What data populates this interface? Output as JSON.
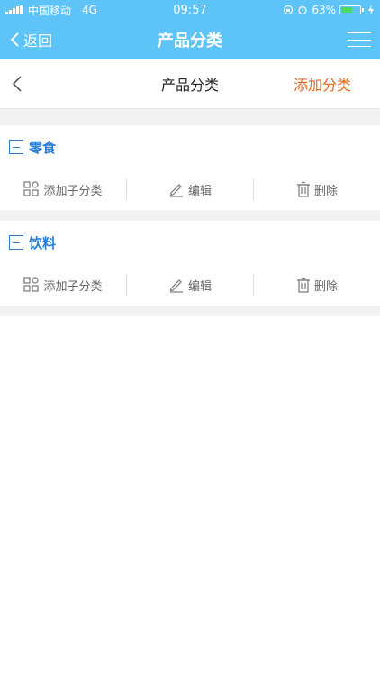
{
  "status": {
    "carrier": "中国移动",
    "network": "4G",
    "time": "09:57",
    "battery_percent": "63%",
    "battery_level": 0.63,
    "battery_color": "#4cd964"
  },
  "nav": {
    "back_label": "返回",
    "title": "产品分类",
    "menu_icon": "hamburger-icon",
    "bg_color": "#5ec3f7"
  },
  "subheader": {
    "title": "产品分类",
    "add_label": "添加分类",
    "add_color": "#e8671e"
  },
  "categories": [
    {
      "name": "零食",
      "actions": {
        "add_child": "添加子分类",
        "edit": "编辑",
        "delete": "删除"
      }
    },
    {
      "name": "饮料",
      "actions": {
        "add_child": "添加子分类",
        "edit": "编辑",
        "delete": "删除"
      }
    }
  ],
  "accent_color": "#2a7fd4"
}
